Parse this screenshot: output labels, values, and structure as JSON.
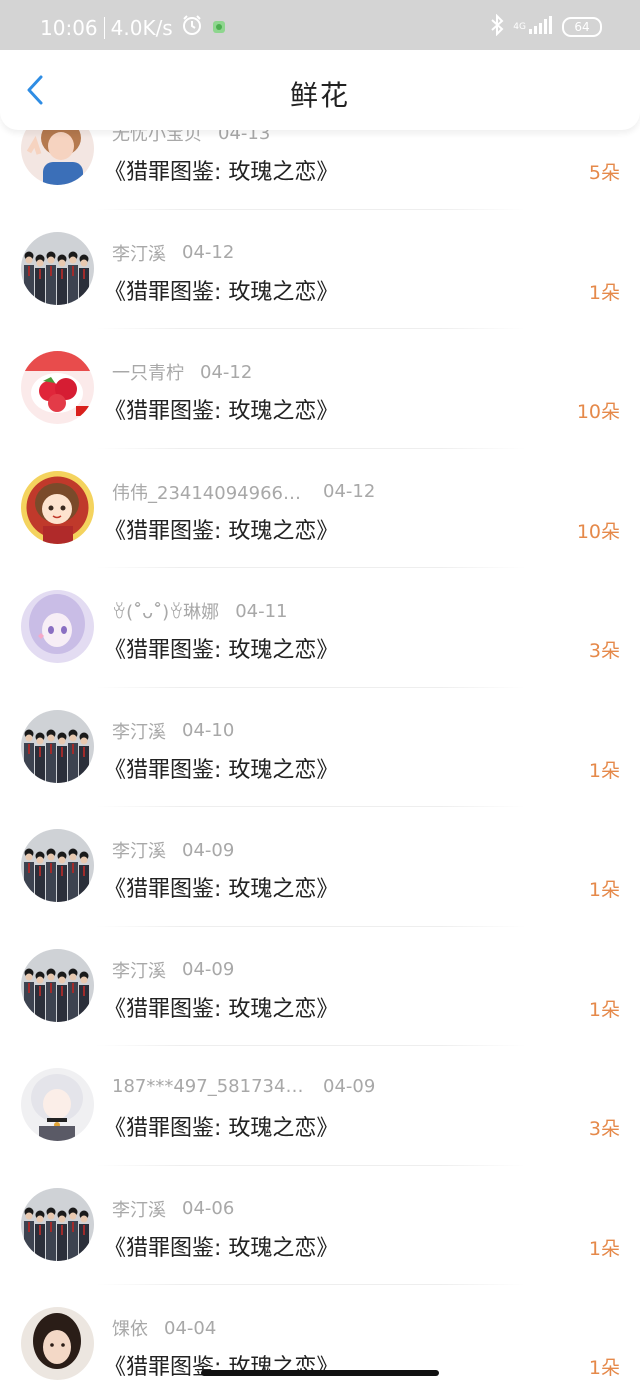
{
  "status_bar": {
    "time": "10:06",
    "speed": "4.0K/s",
    "network": "4G",
    "battery": "64",
    "icons": [
      "alarm-icon",
      "app-notification-icon",
      "bluetooth-icon",
      "signal-icon",
      "battery-icon"
    ]
  },
  "header": {
    "title": "鲜花",
    "back_icon": "chevron-left-icon",
    "accent_color": "#2f8de4"
  },
  "colors": {
    "count": "#e5894a",
    "meta": "#a8a8a8",
    "text": "#222222"
  },
  "records": [
    {
      "name": "无忧小宝贝",
      "date": "04-13",
      "book": "《猎罪图鉴: 玫瑰之恋》",
      "count": "5朵",
      "avatar": "girl-avatar"
    },
    {
      "name": "李汀溪",
      "date": "04-12",
      "book": "《猎罪图鉴: 玫瑰之恋》",
      "count": "1朵",
      "avatar": "group-photo-avatar"
    },
    {
      "name": "一只青柠",
      "date": "04-12",
      "book": "《猎罪图鉴: 玫瑰之恋》",
      "count": "10朵",
      "avatar": "strawberry-avatar"
    },
    {
      "name": "伟伟_234140949662…",
      "date": "04-12",
      "book": "《猎罪图鉴: 玫瑰之恋》",
      "count": "10朵",
      "avatar": "cartoon-girl-avatar"
    },
    {
      "name": "ꈊ(˚̆ᴗ˚̆)ꈊ琳娜",
      "date": "04-11",
      "book": "《猎罪图鉴: 玫瑰之恋》",
      "count": "3朵",
      "avatar": "anime-girl-avatar"
    },
    {
      "name": "李汀溪",
      "date": "04-10",
      "book": "《猎罪图鉴: 玫瑰之恋》",
      "count": "1朵",
      "avatar": "group-photo-avatar"
    },
    {
      "name": "李汀溪",
      "date": "04-09",
      "book": "《猎罪图鉴: 玫瑰之恋》",
      "count": "1朵",
      "avatar": "group-photo-avatar"
    },
    {
      "name": "李汀溪",
      "date": "04-09",
      "book": "《猎罪图鉴: 玫瑰之恋》",
      "count": "1朵",
      "avatar": "group-photo-avatar"
    },
    {
      "name": "187***497_5817340…",
      "date": "04-09",
      "book": "《猎罪图鉴: 玫瑰之恋》",
      "count": "3朵",
      "avatar": "anime-white-hair-avatar"
    },
    {
      "name": "李汀溪",
      "date": "04-06",
      "book": "《猎罪图鉴: 玫瑰之恋》",
      "count": "1朵",
      "avatar": "group-photo-avatar"
    },
    {
      "name": "馃依",
      "date": "04-04",
      "book": "《猎罪图鉴: 玫瑰之恋》",
      "count": "1朵",
      "avatar": "selfie-avatar"
    }
  ]
}
